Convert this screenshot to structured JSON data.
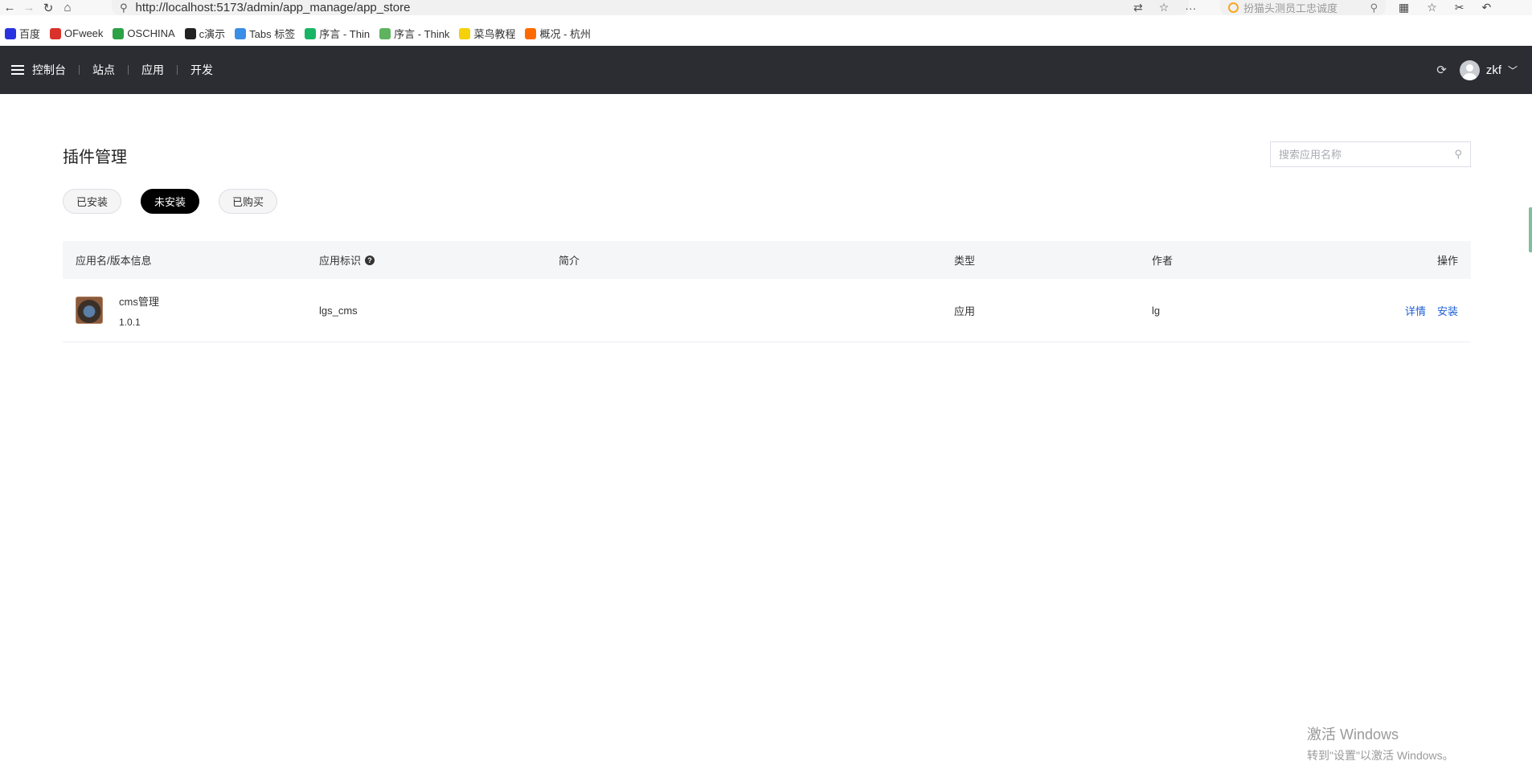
{
  "browser": {
    "url": "http://localhost:5173/admin/app_manage/app_store",
    "search_placeholder": "扮猫头测员工忠诚度",
    "bookmarks": [
      {
        "label": "百度",
        "color": "#2932e1",
        "icon": "paw-icon"
      },
      {
        "label": "OFweek",
        "color": "#d9322b",
        "icon": "of-icon"
      },
      {
        "label": "OSCHINA",
        "color": "#2ba245",
        "icon": "oschina-icon"
      },
      {
        "label": "c演示",
        "color": "#222222",
        "icon": "m-icon"
      },
      {
        "label": "Tabs 标签",
        "color": "#3a8ee6",
        "icon": "cube-icon"
      },
      {
        "label": "序言 - Thin",
        "color": "#18b566",
        "icon": "tp-icon"
      },
      {
        "label": "序言 - Think",
        "color": "#5fb35f",
        "icon": "cloud-icon"
      },
      {
        "label": "菜鸟教程",
        "color": "#f5d10c",
        "icon": "bird-icon"
      },
      {
        "label": "概况 - 杭州",
        "color": "#ff6a00",
        "icon": "aliyun-icon"
      }
    ]
  },
  "header": {
    "nav": [
      "控制台",
      "站点",
      "应用",
      "开发"
    ],
    "username": "zkf"
  },
  "page": {
    "title": "插件管理",
    "search_placeholder": "搜索应用名称",
    "tabs": [
      {
        "label": "已安装",
        "active": false
      },
      {
        "label": "未安装",
        "active": true
      },
      {
        "label": "已购买",
        "active": false
      }
    ]
  },
  "table": {
    "columns": [
      "应用名/版本信息",
      "应用标识",
      "简介",
      "类型",
      "作者",
      "操作"
    ],
    "rows": [
      {
        "name": "cms管理",
        "version": "1.0.1",
        "key": "lgs_cms",
        "desc": "",
        "type": "应用",
        "author": "lg",
        "actions": [
          "详情",
          "安装"
        ]
      }
    ]
  },
  "watermark": {
    "line1": "激活 Windows",
    "line2": "转到\"设置\"以激活 Windows。"
  }
}
